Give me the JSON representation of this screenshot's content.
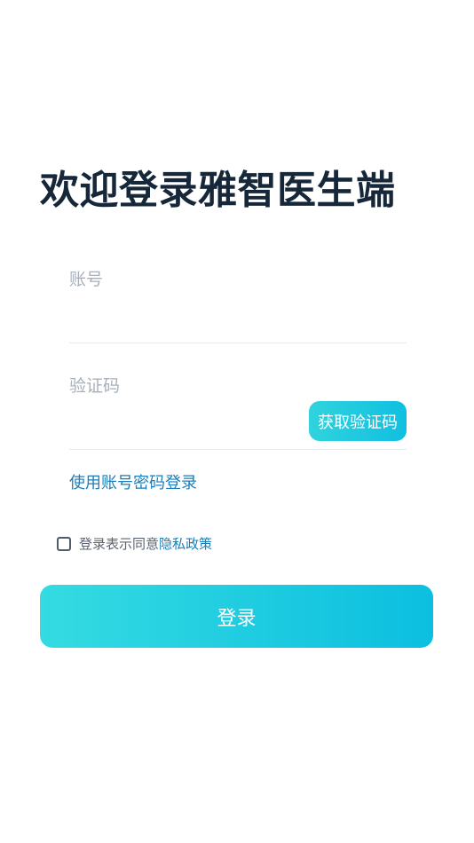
{
  "page": {
    "title": "欢迎登录雅智医生端"
  },
  "form": {
    "account_placeholder": "账号",
    "account_value": "",
    "code_placeholder": "验证码",
    "code_value": "",
    "get_code_label": "获取验证码",
    "switch_login_label": "使用账号密码登录",
    "agreement_prefix": "登录表示同意",
    "privacy_link_label": "隐私政策",
    "login_button_label": "登录",
    "checkbox_checked": false
  },
  "colors": {
    "accent": "#10bfe0",
    "link": "#1b7db9",
    "title": "#17273a"
  }
}
